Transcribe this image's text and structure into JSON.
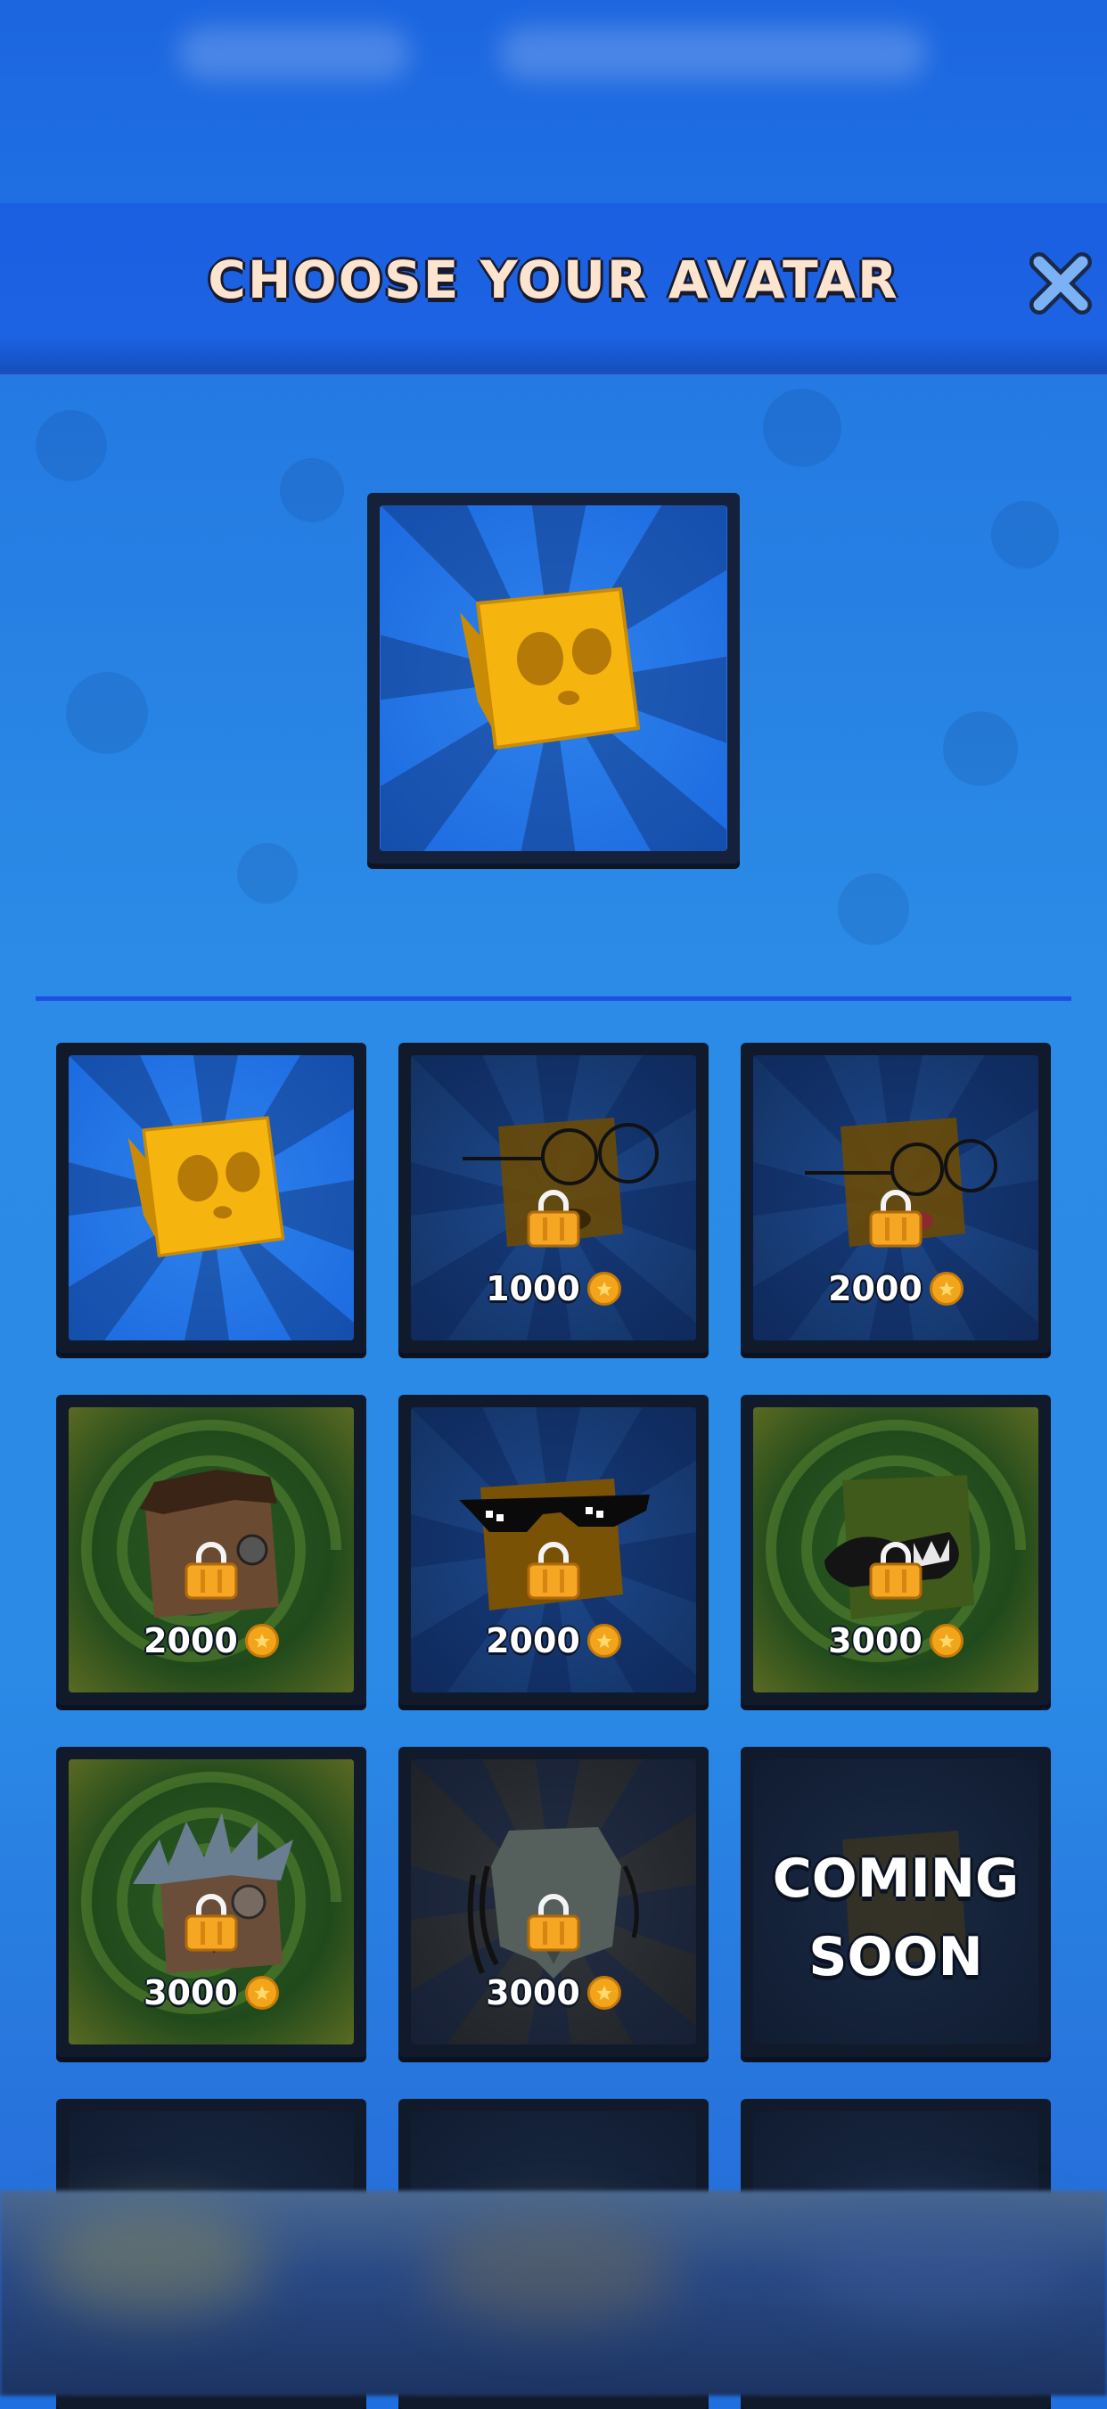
{
  "header": {
    "title": "CHOOSE YOUR AVATAR",
    "close_icon": "close-x-icon"
  },
  "selected_avatar": {
    "name": "yellow-cube",
    "background": "blue-burst"
  },
  "avatars": [
    {
      "id": "yellow-cube",
      "locked": false,
      "price": "",
      "background": "blue-burst"
    },
    {
      "id": "glasses-cube",
      "locked": true,
      "price": "1000",
      "background": "navy-burst"
    },
    {
      "id": "glasses-tongue-cube",
      "locked": true,
      "price": "2000",
      "background": "navy-burst"
    },
    {
      "id": "brown-hair-cube",
      "locked": true,
      "price": "2000",
      "background": "green-swirl"
    },
    {
      "id": "sunglasses-cube",
      "locked": true,
      "price": "2000",
      "background": "navy-burst"
    },
    {
      "id": "green-monster-cube",
      "locked": true,
      "price": "3000",
      "background": "green-swirl"
    },
    {
      "id": "spiky-hair-cube",
      "locked": true,
      "price": "3000",
      "background": "green-swirl"
    },
    {
      "id": "predator-mask-cube",
      "locked": true,
      "price": "3000",
      "background": "dark-burst"
    },
    {
      "id": "coming-soon",
      "locked": true,
      "price": "",
      "background": "dark"
    }
  ],
  "coming_soon": {
    "line1": "COMING",
    "line2": "SOON"
  },
  "colors": {
    "title_text": "#fde4cf",
    "header_bg": "#1a5fe0",
    "coin": "#f2a51a",
    "lock": "#f5a623"
  }
}
